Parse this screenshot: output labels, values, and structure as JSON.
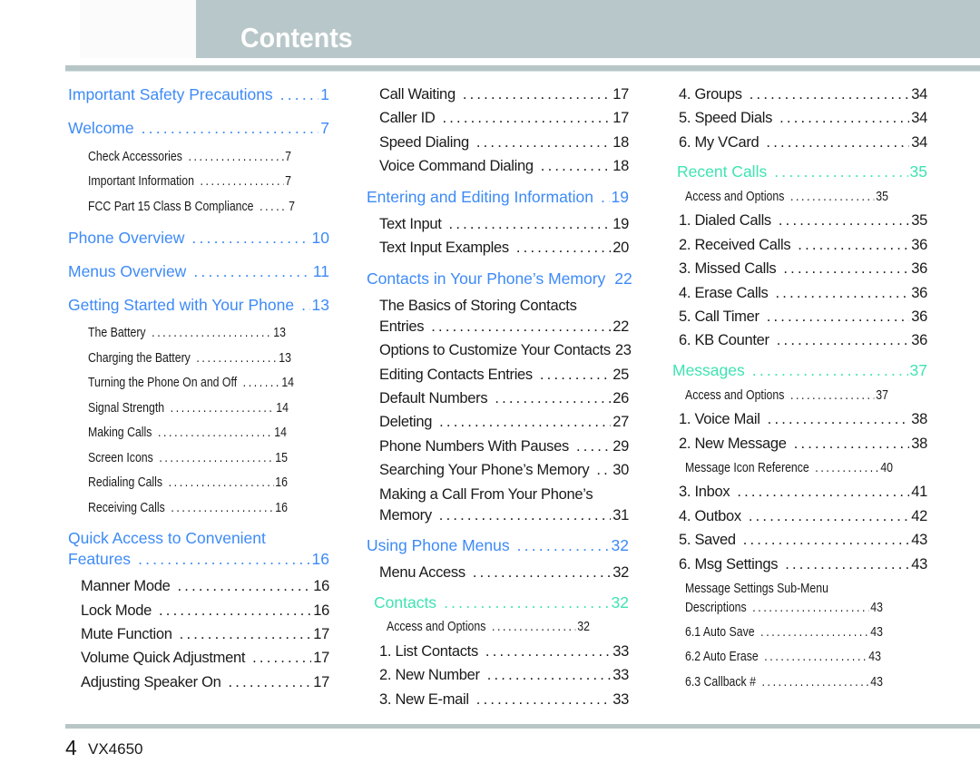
{
  "header": {
    "title": "Contents"
  },
  "footer": {
    "page_number": "4",
    "model": "VX4650"
  },
  "colors": {
    "blue": "#3d8af7",
    "green": "#3fe3b3",
    "text": "#1a1a1a",
    "bar": "#b8c7c9"
  },
  "columns": [
    [
      {
        "label": "Important Safety Precautions",
        "page": "1",
        "style": "heading",
        "accent": "blue"
      },
      {
        "label": "Welcome",
        "page": "7",
        "style": "heading",
        "accent": "blue"
      },
      {
        "label": "Check Accessories",
        "page": "7",
        "style": "sub"
      },
      {
        "label": "Important Information",
        "page": "7",
        "style": "sub"
      },
      {
        "label": "FCC Part 15 Class B Compliance",
        "page": "7",
        "style": "sub"
      },
      {
        "label": "Phone Overview",
        "page": "10",
        "style": "heading",
        "accent": "blue"
      },
      {
        "label": "Menus Overview",
        "page": "11",
        "style": "heading",
        "accent": "blue"
      },
      {
        "label": "Getting Started with Your Phone",
        "page": "13",
        "style": "heading",
        "accent": "blue"
      },
      {
        "label": "The Battery",
        "page": "13",
        "style": "sub"
      },
      {
        "label": "Charging the Battery",
        "page": "13",
        "style": "sub"
      },
      {
        "label": "Turning the Phone On and Off",
        "page": "14",
        "style": "sub"
      },
      {
        "label": "Signal Strength",
        "page": "14",
        "style": "sub"
      },
      {
        "label": "Making Calls",
        "page": "14",
        "style": "sub"
      },
      {
        "label": "Screen Icons",
        "page": "15",
        "style": "sub"
      },
      {
        "label": "Redialing Calls",
        "page": "16",
        "style": "sub"
      },
      {
        "label": "Receiving Calls",
        "page": "16",
        "style": "sub"
      },
      {
        "label": "Quick Access to Convenient",
        "label2": "Features",
        "page": "16",
        "style": "heading",
        "accent": "blue"
      },
      {
        "label": "Manner Mode",
        "page": "16",
        "style": "item"
      },
      {
        "label": "Lock Mode",
        "page": "16",
        "style": "item"
      },
      {
        "label": "Mute Function",
        "page": "17",
        "style": "item"
      },
      {
        "label": "Volume Quick Adjustment",
        "page": "17",
        "style": "item"
      },
      {
        "label": "Adjusting Speaker On",
        "page": "17",
        "style": "item"
      }
    ],
    [
      {
        "label": "Call Waiting",
        "page": "17",
        "style": "item"
      },
      {
        "label": "Caller ID",
        "page": "17",
        "style": "item"
      },
      {
        "label": "Speed Dialing",
        "page": "18",
        "style": "item"
      },
      {
        "label": "Voice Command Dialing",
        "page": "18",
        "style": "item"
      },
      {
        "label": "Entering and Editing Information",
        "page": "19",
        "style": "heading",
        "accent": "blue"
      },
      {
        "label": "Text Input",
        "page": "19",
        "style": "item"
      },
      {
        "label": "Text Input Examples",
        "page": "20",
        "style": "item"
      },
      {
        "label": "Contacts in Your Phone’s Memory",
        "page": "22",
        "style": "heading",
        "accent": "blue"
      },
      {
        "label": "The Basics of Storing Contacts",
        "label2": "Entries",
        "page": "22",
        "style": "item"
      },
      {
        "label": "Options to Customize Your Contacts",
        "page": "23",
        "style": "item",
        "nodots": true
      },
      {
        "label": "Editing Contacts Entries",
        "page": "25",
        "style": "item"
      },
      {
        "label": "Default Numbers",
        "page": "26",
        "style": "item"
      },
      {
        "label": "Deleting",
        "page": "27",
        "style": "item"
      },
      {
        "label": "Phone Numbers With Pauses",
        "page": "29",
        "style": "item"
      },
      {
        "label": "Searching Your Phone’s Memory",
        "page": "30",
        "style": "item"
      },
      {
        "label": "Making a Call From Your Phone’s",
        "label2": "Memory",
        "page": "31",
        "style": "item"
      },
      {
        "label": "Using Phone Menus",
        "page": "32",
        "style": "heading",
        "accent": "blue"
      },
      {
        "label": "Menu Access",
        "page": "32",
        "style": "item"
      },
      {
        "label": "Contacts",
        "page": "32",
        "style": "heading",
        "accent": "green"
      },
      {
        "label": "Access and Options",
        "page": "32",
        "style": "sub"
      },
      {
        "label": "1. List Contacts",
        "page": "33",
        "style": "item"
      },
      {
        "label": "2. New Number",
        "page": "33",
        "style": "item"
      },
      {
        "label": "3. New E-mail",
        "page": "33",
        "style": "item"
      }
    ],
    [
      {
        "label": "4. Groups",
        "page": "34",
        "style": "item"
      },
      {
        "label": "5. Speed Dials",
        "page": "34",
        "style": "item"
      },
      {
        "label": "6. My VCard",
        "page": "34",
        "style": "item"
      },
      {
        "label": "Recent Calls",
        "page": "35",
        "style": "heading",
        "accent": "green"
      },
      {
        "label": "Access and Options",
        "page": "35",
        "style": "sub"
      },
      {
        "label": "1. Dialed Calls",
        "page": "35",
        "style": "item"
      },
      {
        "label": "2. Received Calls",
        "page": "36",
        "style": "item"
      },
      {
        "label": "3. Missed Calls",
        "page": "36",
        "style": "item"
      },
      {
        "label": "4. Erase Calls",
        "page": "36",
        "style": "item"
      },
      {
        "label": "5. Call Timer",
        "page": "36",
        "style": "item"
      },
      {
        "label": "6. KB Counter",
        "page": "36",
        "style": "item"
      },
      {
        "label": "Messages",
        "page": "37",
        "style": "heading",
        "accent": "green"
      },
      {
        "label": "Access and Options",
        "page": "37",
        "style": "sub"
      },
      {
        "label": "1. Voice Mail",
        "page": "38",
        "style": "item"
      },
      {
        "label": "2. New Message",
        "page": "38",
        "style": "item"
      },
      {
        "label": "Message Icon Reference",
        "page": "40",
        "style": "sub"
      },
      {
        "label": "3. Inbox",
        "page": "41",
        "style": "item"
      },
      {
        "label": "4. Outbox",
        "page": "42",
        "style": "item"
      },
      {
        "label": "5. Saved",
        "page": "43",
        "style": "item"
      },
      {
        "label": "6. Msg Settings",
        "page": "43",
        "style": "item"
      },
      {
        "label": "Message Settings Sub-Menu",
        "label2": "Descriptions",
        "page": "43",
        "style": "sub"
      },
      {
        "label": "6.1 Auto Save",
        "page": "43",
        "style": "sub"
      },
      {
        "label": "6.2 Auto Erase",
        "page": "43",
        "style": "sub"
      },
      {
        "label": "6.3 Callback #",
        "page": "43",
        "style": "sub"
      }
    ]
  ]
}
